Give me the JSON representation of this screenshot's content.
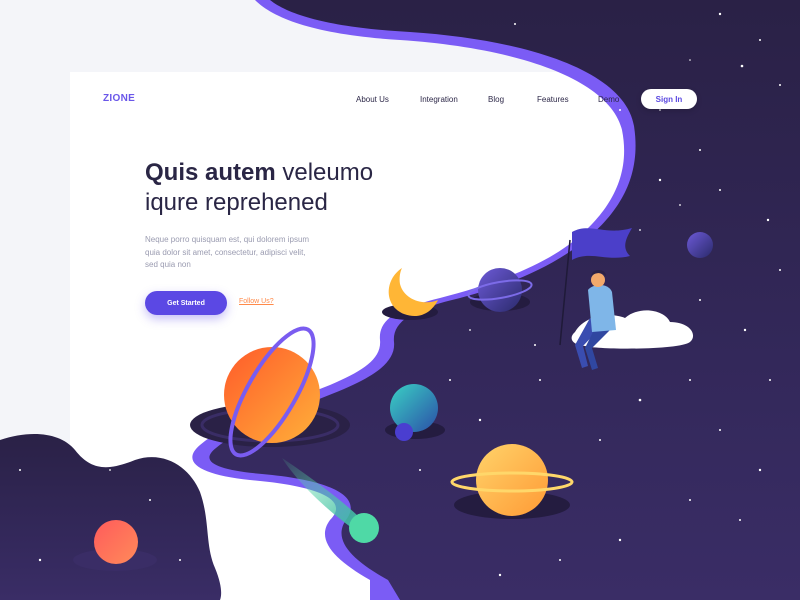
{
  "brand": {
    "logo": "ZIONE"
  },
  "nav": {
    "links": [
      "About Us",
      "Integration",
      "Blog",
      "Features",
      "Demo"
    ],
    "signin_label": "Sign In"
  },
  "hero": {
    "title_bold": "Quis autem",
    "title_rest_line1": " veleumo",
    "title_line2": "iqure reprehened",
    "description": "Neque porro quisquam est, qui dolorem ipsum quia dolor sit amet, consectetur, adipisci velit, sed quia non",
    "primary_button": "Get Started",
    "secondary_link": "Follow Us?"
  },
  "colors": {
    "accent": "#5b48e4",
    "space": "#2e2550",
    "link": "#ff8a4a",
    "text_dark": "#2a2645"
  }
}
